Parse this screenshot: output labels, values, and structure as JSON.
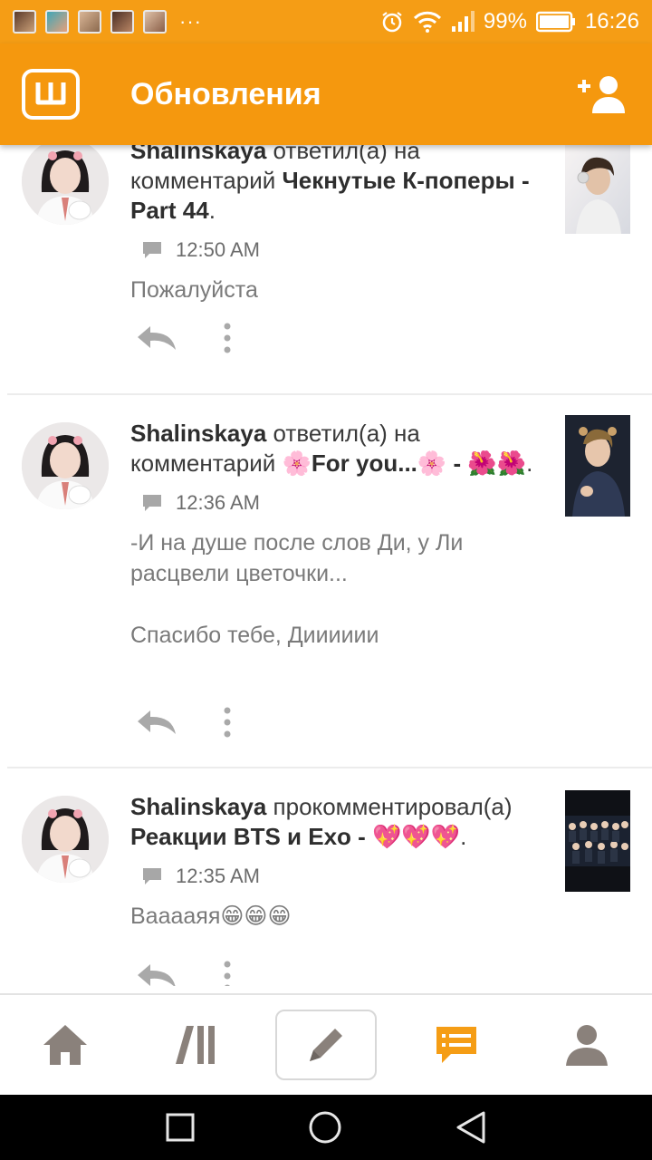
{
  "status_bar": {
    "battery": "99%",
    "time": "16:26",
    "more": "···"
  },
  "app_bar": {
    "title": "Обновления"
  },
  "feed": [
    {
      "user": "Shalinskaya",
      "action": " ответил(а) на комментарий ",
      "target": "Чекнутые К-поперы - Part 44",
      "suffix": ".",
      "time": "12:50 AM",
      "comment": "Пожалуйста"
    },
    {
      "user": "Shalinskaya",
      "action": " ответил(а) на комментарий ",
      "target": "🌸For you...🌸 - 🌺🌺",
      "suffix": ".",
      "time": "12:36 AM",
      "comment": "-И на душе после слов Ди, у Ли расцвели цветочки...\n\nСпасибо тебе, Дииииии"
    },
    {
      "user": "Shalinskaya",
      "action": " прокомментировал(а) ",
      "target": "Реакции BTS и Exo - 💖💖💖",
      "suffix": ".",
      "time": "12:35 AM",
      "comment": "Вааааяя😁😁😁"
    }
  ],
  "colors": {
    "accent": "#f59d15",
    "notify_active": "#f59d15",
    "nav_inactive": "#8a817b"
  }
}
